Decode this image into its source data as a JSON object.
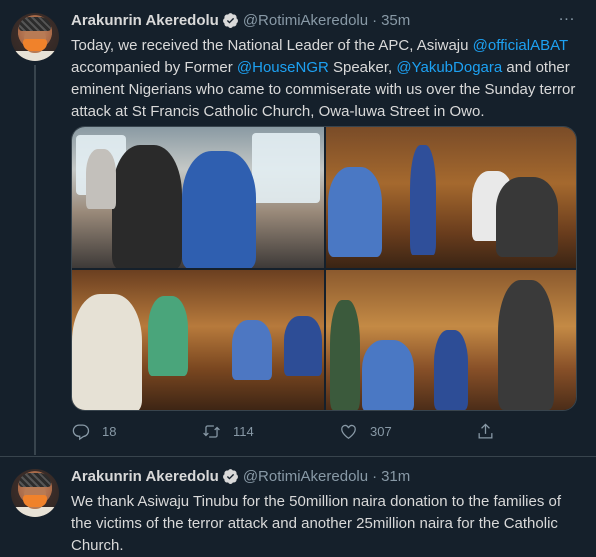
{
  "tweets": [
    {
      "name": "Arakunrin Akeredolu",
      "handle": "@RotimiAkeredolu",
      "time": "35m",
      "text_parts": [
        "Today, we received the National Leader of the APC, Asiwaju ",
        "@officialABAT",
        " accompanied by Former ",
        "@HouseNGR",
        " Speaker, ",
        "@YakubDogara",
        " and other eminent Nigerians who came to commiserate with us over the Sunday terror attack at St Francis Catholic Church, Owa-luwa Street in Owo."
      ],
      "replies": "18",
      "retweets": "114",
      "likes": "307"
    },
    {
      "name": "Arakunrin Akeredolu",
      "handle": "@RotimiAkeredolu",
      "time": "31m",
      "text": "We thank Asiwaju Tinubu for the 50million naira donation to the families of the victims of the terror attack and another 25million naira for the Catholic Church."
    }
  ],
  "icons": {
    "verified": "verified-badge-icon",
    "more": "more-icon",
    "reply": "reply-icon",
    "retweet": "retweet-icon",
    "like": "like-icon",
    "share": "share-icon"
  },
  "colors": {
    "background": "#15202b",
    "accent": "#1da1f2",
    "muted": "#8899a6",
    "border": "#38444d"
  }
}
